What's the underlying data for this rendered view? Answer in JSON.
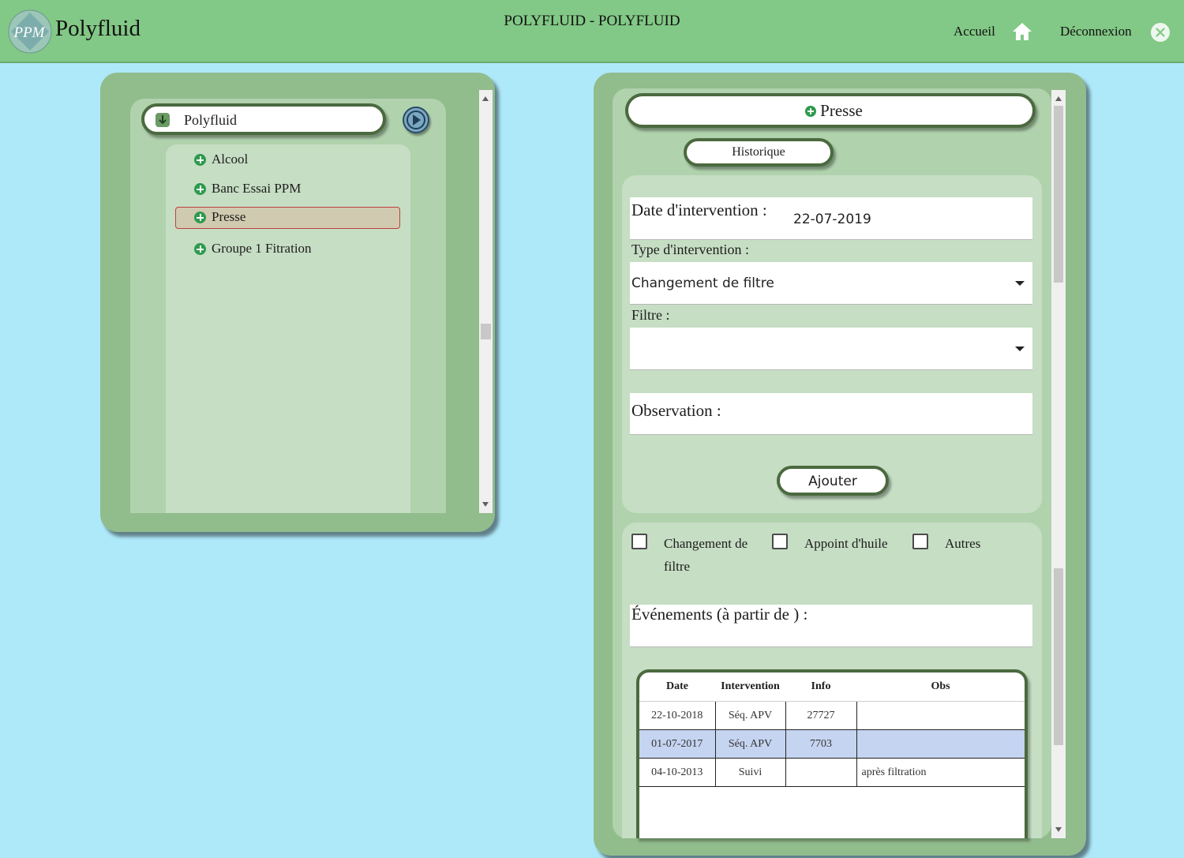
{
  "header": {
    "brand": "Polyfluid",
    "logo_text": "PPM",
    "app_title": "POLYFLUID - POLYFLUID",
    "nav_home": "Accueil",
    "nav_logout": "Déconnexion"
  },
  "tree": {
    "root_label": "Polyfluid",
    "items": [
      {
        "label": "Alcool",
        "selected": false
      },
      {
        "label": "Banc Essai PPM",
        "selected": false
      },
      {
        "label": "Presse",
        "selected": true
      },
      {
        "label": "Groupe 1 Fitration",
        "selected": false
      }
    ]
  },
  "detail": {
    "title": "Presse",
    "history_button": "Historique",
    "date_label": "Date d'intervention :",
    "date_value": "22-07-2019",
    "type_label": "Type d'intervention :",
    "type_value": "Changement de filtre",
    "filter_label": "Filtre :",
    "filter_value": "",
    "observation_label": "Observation :",
    "add_button": "Ajouter"
  },
  "filters": {
    "options": [
      {
        "label_line1": "Changement de",
        "label_line2": "filtre",
        "checked": false
      },
      {
        "label_line1": "Appoint d'huile",
        "label_line2": "",
        "checked": false
      },
      {
        "label_line1": "Autres",
        "label_line2": "",
        "checked": false
      }
    ],
    "events_label": "Événements (à partir de ) :"
  },
  "events_table": {
    "columns": [
      "Date",
      "Intervention",
      "Info",
      "Obs"
    ],
    "rows": [
      {
        "date": "22-10-2018",
        "intervention": "Séq. APV",
        "info": "27727",
        "obs": "",
        "selected": false
      },
      {
        "date": "01-07-2017",
        "intervention": "Séq. APV",
        "info": "7703",
        "obs": "",
        "selected": true
      },
      {
        "date": "04-10-2013",
        "intervention": "Suivi",
        "info": "",
        "obs": "après filtration",
        "selected": false
      }
    ]
  },
  "colors": {
    "header_bg": "#82c886",
    "page_bg": "#aee9fa",
    "panel_bg": "#91bc8c",
    "selected_item_border": "#c0403b",
    "selected_row_bg": "#c5d4f0"
  }
}
